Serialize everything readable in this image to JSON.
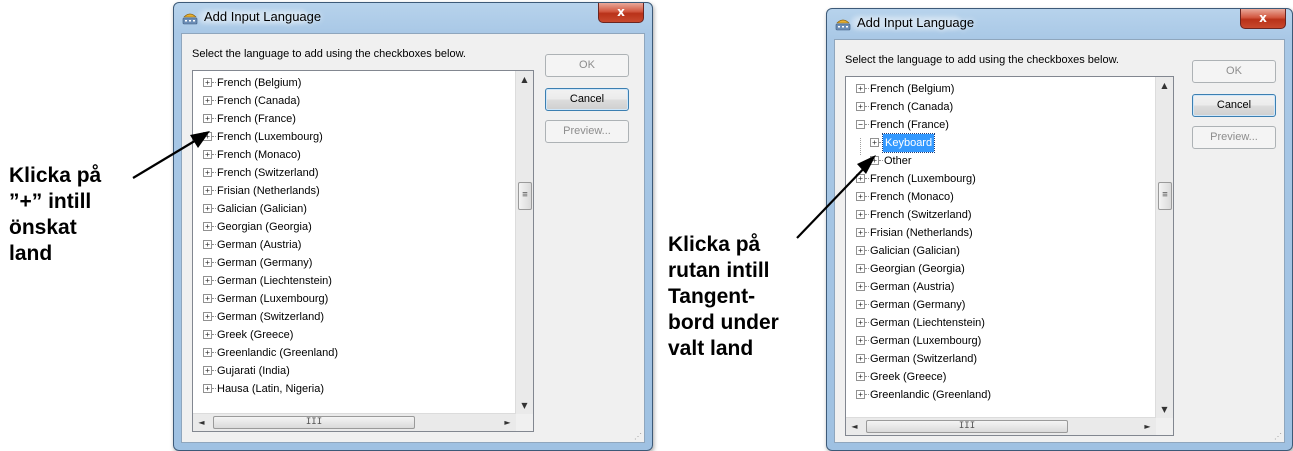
{
  "left_caption": [
    "Klicka på",
    "”+” intill",
    "önskat",
    "land"
  ],
  "right_caption": [
    "Klicka på",
    "rutan intill",
    "Tangent-",
    "bord under",
    "valt land"
  ],
  "dialog_left": {
    "title": "Add Input Language",
    "close_glyph": "x",
    "instruction": "Select the language to add using the checkboxes below.",
    "buttons": {
      "ok": "OK",
      "cancel": "Cancel",
      "preview": "Preview..."
    },
    "tree_items": [
      {
        "label": "French (Belgium)",
        "expander": "+"
      },
      {
        "label": "French (Canada)",
        "expander": "+"
      },
      {
        "label": "French (France)",
        "expander": "+"
      },
      {
        "label": "French (Luxembourg)",
        "expander": "+"
      },
      {
        "label": "French (Monaco)",
        "expander": "+"
      },
      {
        "label": "French (Switzerland)",
        "expander": "+"
      },
      {
        "label": "Frisian (Netherlands)",
        "expander": "+"
      },
      {
        "label": "Galician (Galician)",
        "expander": "+"
      },
      {
        "label": "Georgian (Georgia)",
        "expander": "+"
      },
      {
        "label": "German (Austria)",
        "expander": "+"
      },
      {
        "label": "German (Germany)",
        "expander": "+"
      },
      {
        "label": "German (Liechtenstein)",
        "expander": "+"
      },
      {
        "label": "German (Luxembourg)",
        "expander": "+"
      },
      {
        "label": "German (Switzerland)",
        "expander": "+"
      },
      {
        "label": "Greek (Greece)",
        "expander": "+"
      },
      {
        "label": "Greenlandic (Greenland)",
        "expander": "+"
      },
      {
        "label": "Gujarati (India)",
        "expander": "+"
      },
      {
        "label": "Hausa (Latin, Nigeria)",
        "expander": "+"
      }
    ],
    "scrollbar": {
      "up": "▲",
      "down": "▼",
      "left": "◄",
      "right": "►",
      "vthumb": "≡",
      "hthumb": "III"
    }
  },
  "dialog_right": {
    "title": "Add Input Language",
    "close_glyph": "x",
    "instruction": "Select the language to add using the checkboxes below.",
    "buttons": {
      "ok": "OK",
      "cancel": "Cancel",
      "preview": "Preview..."
    },
    "tree_items": [
      {
        "label": "French (Belgium)",
        "expander": "+",
        "level": 0
      },
      {
        "label": "French (Canada)",
        "expander": "+",
        "level": 0
      },
      {
        "label": "French (France)",
        "expander": "−",
        "level": 0
      },
      {
        "label": "Keyboard",
        "expander": "+",
        "level": 1,
        "selected": true
      },
      {
        "label": "Other",
        "expander": "+",
        "level": 1
      },
      {
        "label": "French (Luxembourg)",
        "expander": "+",
        "level": 0
      },
      {
        "label": "French (Monaco)",
        "expander": "+",
        "level": 0
      },
      {
        "label": "French (Switzerland)",
        "expander": "+",
        "level": 0
      },
      {
        "label": "Frisian (Netherlands)",
        "expander": "+",
        "level": 0
      },
      {
        "label": "Galician (Galician)",
        "expander": "+",
        "level": 0
      },
      {
        "label": "Georgian (Georgia)",
        "expander": "+",
        "level": 0
      },
      {
        "label": "German (Austria)",
        "expander": "+",
        "level": 0
      },
      {
        "label": "German (Germany)",
        "expander": "+",
        "level": 0
      },
      {
        "label": "German (Liechtenstein)",
        "expander": "+",
        "level": 0
      },
      {
        "label": "German (Luxembourg)",
        "expander": "+",
        "level": 0
      },
      {
        "label": "German (Switzerland)",
        "expander": "+",
        "level": 0
      },
      {
        "label": "Greek (Greece)",
        "expander": "+",
        "level": 0
      },
      {
        "label": "Greenlandic (Greenland)",
        "expander": "+",
        "level": 0
      }
    ],
    "scrollbar": {
      "up": "▲",
      "down": "▼",
      "left": "◄",
      "right": "►",
      "vthumb": "≡",
      "hthumb": "III"
    }
  },
  "icons": {
    "title_icon": "keyboard-language-icon",
    "arrow": "annotation-arrow-icon"
  },
  "colors": {
    "selection": "#3399ff",
    "close_button": "#c8492e",
    "frame": "#a9c8e6"
  }
}
